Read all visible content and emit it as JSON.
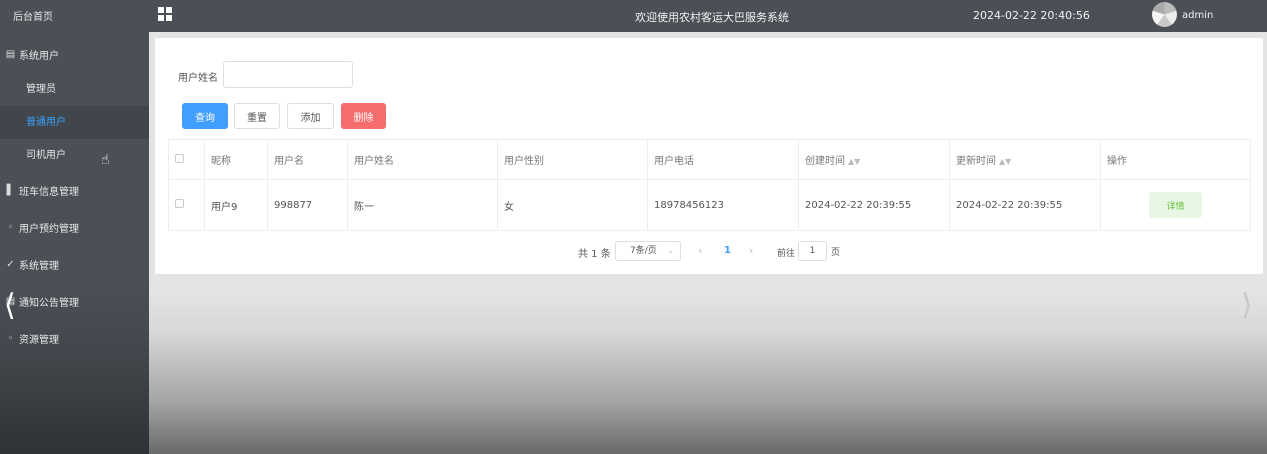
{
  "sidebar": {
    "home": "后台首页",
    "groups": [
      {
        "label": "系统用户",
        "icon": "document-icon"
      },
      {
        "label": "班车信息管理",
        "icon": "bar-chart-icon"
      },
      {
        "label": "用户预约管理",
        "icon": "chat-icon"
      },
      {
        "label": "系统管理",
        "icon": "check-circle-icon"
      },
      {
        "label": "通知公告管理",
        "icon": "document-icon"
      },
      {
        "label": "资源管理",
        "icon": "chat-icon"
      }
    ],
    "sub_items": [
      "管理员",
      "普通用户",
      "司机用户"
    ],
    "active_sub": "普通用户"
  },
  "topbar": {
    "title": "欢迎使用农村客运大巴服务系统",
    "datetime": "2024-02-22 20:40:56",
    "user": "admin"
  },
  "search": {
    "label": "用户姓名",
    "value": ""
  },
  "buttons": {
    "query": "查询",
    "reset": "重置",
    "add": "添加",
    "delete": "删除"
  },
  "table": {
    "columns": [
      "昵称",
      "用户名",
      "用户姓名",
      "用户性别",
      "用户电话",
      "创建时间",
      "更新时间",
      "操作"
    ],
    "rows": [
      {
        "nickname": "用户9",
        "username": "998877",
        "realname": "陈一",
        "gender": "女",
        "phone": "18978456123",
        "created": "2024-02-22 20:39:55",
        "updated": "2024-02-22 20:39:55",
        "action": "详情"
      }
    ]
  },
  "pagination": {
    "total": "共 1 条",
    "page_size": "7条/页",
    "current_page": "1",
    "goto_label": "前往",
    "goto_value": "1",
    "page_suffix": "页"
  },
  "colors": {
    "primary": "#409eff",
    "danger": "#f56c6c",
    "success": "#67c23a",
    "sidebar_bg": "#4a5056"
  }
}
